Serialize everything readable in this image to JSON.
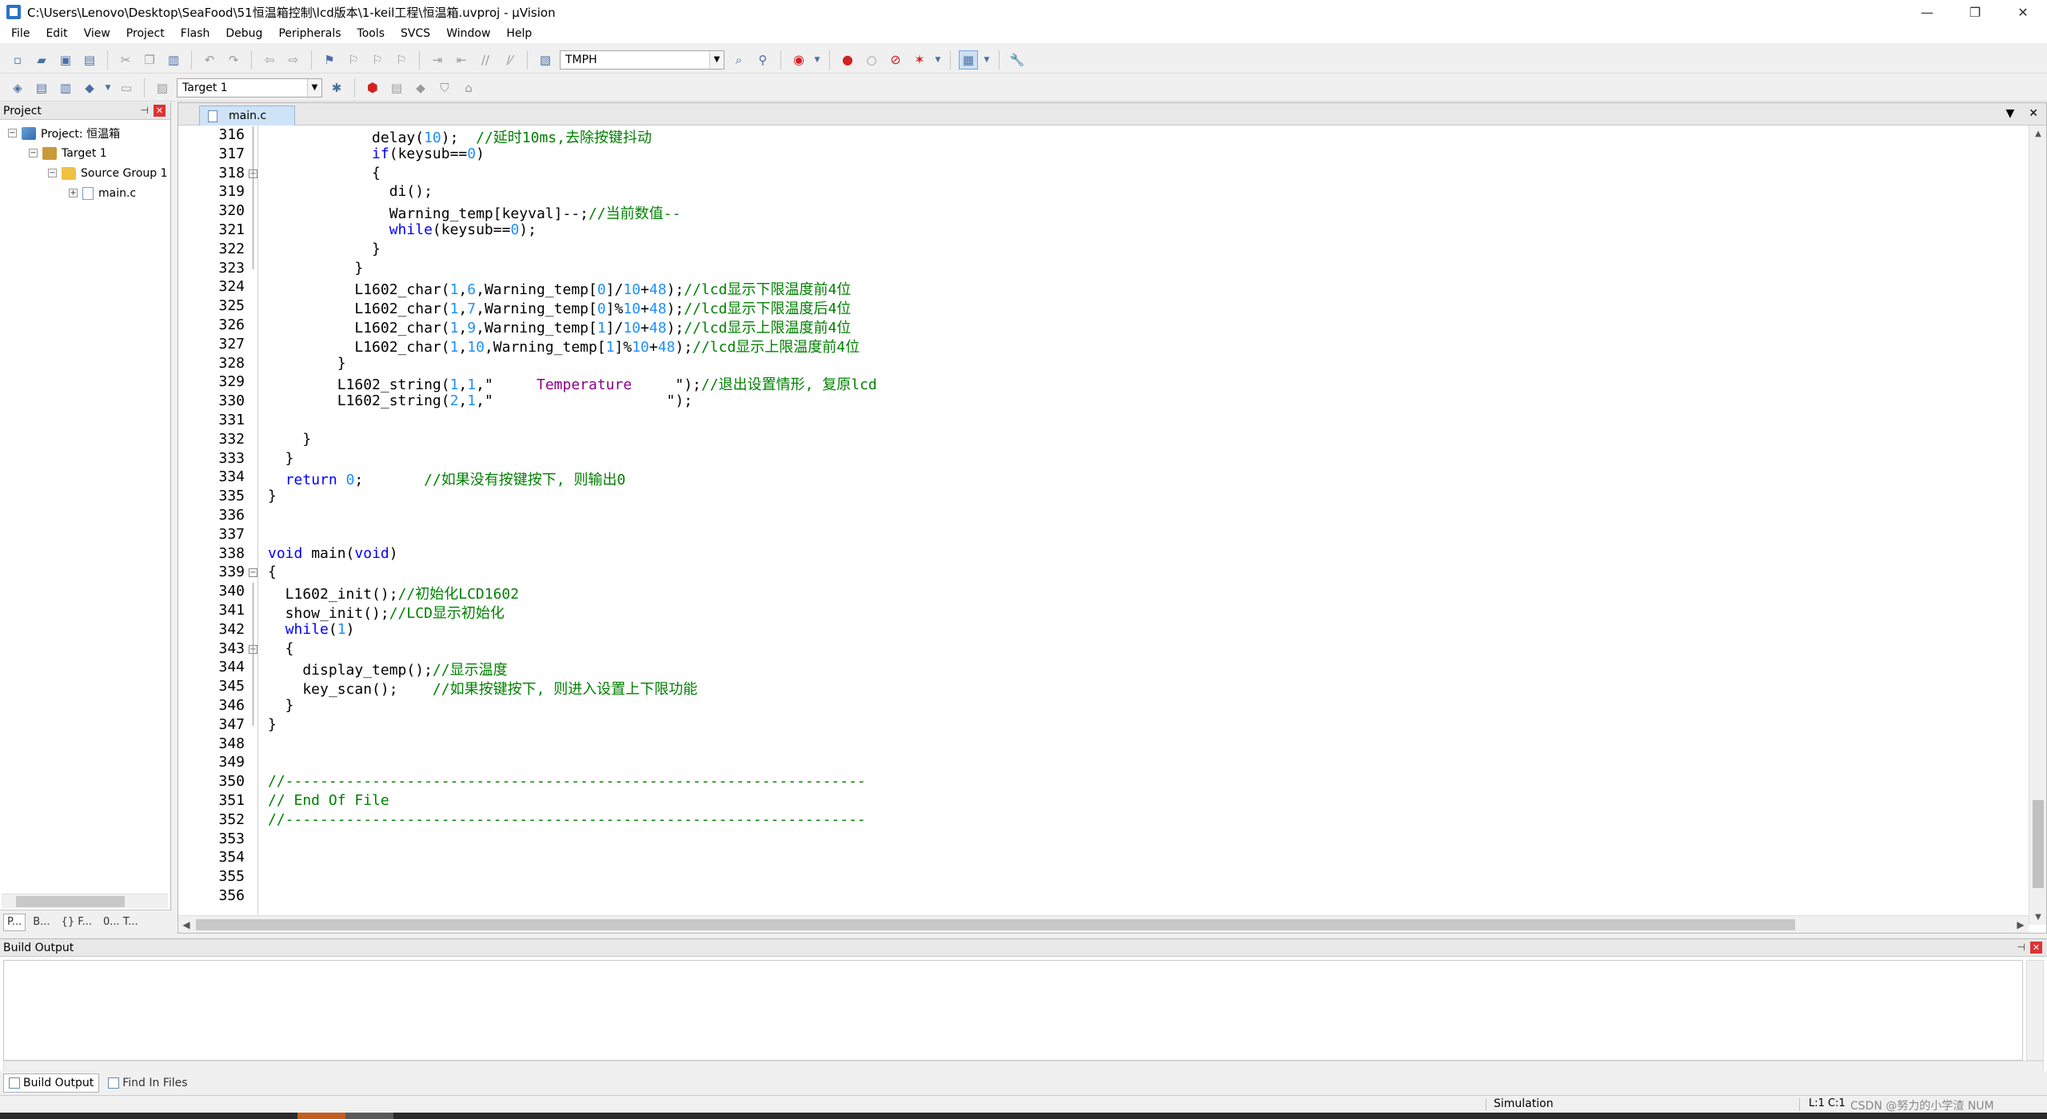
{
  "window": {
    "title": "C:\\Users\\Lenovo\\Desktop\\SeaFood\\51恒温箱控制\\lcd版本\\1-keil工程\\恒温箱.uvproj - µVision",
    "minimize": "—",
    "maximize": "❐",
    "close": "✕"
  },
  "menu": [
    "File",
    "Edit",
    "View",
    "Project",
    "Flash",
    "Debug",
    "Peripherals",
    "Tools",
    "SVCS",
    "Window",
    "Help"
  ],
  "toolbar1": {
    "find_combo_value": "TMPH"
  },
  "toolbar2": {
    "target_combo_value": "Target 1"
  },
  "project_panel": {
    "title": "Project",
    "tree": [
      {
        "label": "Project: 恒温箱",
        "icon": "project-icon",
        "level": 0,
        "expander": "−"
      },
      {
        "label": "Target 1",
        "icon": "target-icon",
        "level": 1,
        "expander": "−"
      },
      {
        "label": "Source Group 1",
        "icon": "folder-icon",
        "level": 2,
        "expander": "−"
      },
      {
        "label": "main.c",
        "icon": "file-icon",
        "level": 3,
        "expander": "+"
      }
    ],
    "tabs": [
      "P...",
      "B...",
      "{} F...",
      "0... T..."
    ]
  },
  "editor": {
    "tab_label": "main.c",
    "tab_menu": "▼",
    "tab_close": "✕",
    "lines": [
      {
        "n": "316",
        "tokens": [
          [
            "            delay(",
            ""
          ],
          [
            "10",
            "num"
          ],
          [
            ");  ",
            ""
          ],
          [
            "//延时10ms,去除按键抖动",
            "cmt"
          ]
        ]
      },
      {
        "n": "317",
        "tokens": [
          [
            "            ",
            ""
          ],
          [
            "if",
            "kw"
          ],
          [
            "(keysub==",
            ""
          ],
          [
            "0",
            "num"
          ],
          [
            ")",
            ""
          ]
        ]
      },
      {
        "n": "318",
        "fold": "−",
        "tokens": [
          [
            "            {",
            ""
          ]
        ]
      },
      {
        "n": "319",
        "tokens": [
          [
            "              di();",
            ""
          ]
        ]
      },
      {
        "n": "320",
        "tokens": [
          [
            "              Warning_temp[keyval]--;",
            ""
          ],
          [
            "//当前数值--",
            "cmt"
          ]
        ]
      },
      {
        "n": "321",
        "tokens": [
          [
            "              ",
            ""
          ],
          [
            "while",
            "kw"
          ],
          [
            "(keysub==",
            ""
          ],
          [
            "0",
            "num"
          ],
          [
            ");",
            ""
          ]
        ]
      },
      {
        "n": "322",
        "tokens": [
          [
            "            }",
            ""
          ]
        ]
      },
      {
        "n": "323",
        "tokens": [
          [
            "          }",
            ""
          ]
        ]
      },
      {
        "n": "324",
        "tokens": [
          [
            "          L1602_char(",
            ""
          ],
          [
            "1",
            "num"
          ],
          [
            ",",
            ""
          ],
          [
            "6",
            "num"
          ],
          [
            ",Warning_temp[",
            ""
          ],
          [
            "0",
            "num"
          ],
          [
            "]/",
            ""
          ],
          [
            "10",
            "num"
          ],
          [
            "+",
            ""
          ],
          [
            "48",
            "num"
          ],
          [
            ");",
            ""
          ],
          [
            "//lcd显示下限温度前4位",
            "cmt"
          ]
        ]
      },
      {
        "n": "325",
        "tokens": [
          [
            "          L1602_char(",
            ""
          ],
          [
            "1",
            "num"
          ],
          [
            ",",
            ""
          ],
          [
            "7",
            "num"
          ],
          [
            ",Warning_temp[",
            ""
          ],
          [
            "0",
            "num"
          ],
          [
            "]%",
            ""
          ],
          [
            "10",
            "num"
          ],
          [
            "+",
            ""
          ],
          [
            "48",
            "num"
          ],
          [
            ");",
            ""
          ],
          [
            "//lcd显示下限温度后4位",
            "cmt"
          ]
        ]
      },
      {
        "n": "326",
        "tokens": [
          [
            "          L1602_char(",
            ""
          ],
          [
            "1",
            "num"
          ],
          [
            ",",
            ""
          ],
          [
            "9",
            "num"
          ],
          [
            ",Warning_temp[",
            ""
          ],
          [
            "1",
            "num"
          ],
          [
            "]/",
            ""
          ],
          [
            "10",
            "num"
          ],
          [
            "+",
            ""
          ],
          [
            "48",
            "num"
          ],
          [
            ");",
            ""
          ],
          [
            "//lcd显示上限温度前4位",
            "cmt"
          ]
        ]
      },
      {
        "n": "327",
        "tokens": [
          [
            "          L1602_char(",
            ""
          ],
          [
            "1",
            "num"
          ],
          [
            ",",
            ""
          ],
          [
            "10",
            "num"
          ],
          [
            ",Warning_temp[",
            ""
          ],
          [
            "1",
            "num"
          ],
          [
            "]%",
            ""
          ],
          [
            "10",
            "num"
          ],
          [
            "+",
            ""
          ],
          [
            "48",
            "num"
          ],
          [
            ");",
            ""
          ],
          [
            "//lcd显示上限温度前4位",
            "cmt"
          ]
        ]
      },
      {
        "n": "328",
        "tokens": [
          [
            "        }",
            ""
          ]
        ]
      },
      {
        "n": "329",
        "tokens": [
          [
            "        L1602_string(",
            ""
          ],
          [
            "1",
            "num"
          ],
          [
            ",",
            ""
          ],
          [
            "1",
            "num"
          ],
          [
            ",\"",
            ""
          ],
          [
            "     Temperature     ",
            "str"
          ],
          [
            "\");",
            ""
          ],
          [
            "//退出设置情形, 复原lcd",
            "cmt"
          ]
        ]
      },
      {
        "n": "330",
        "tokens": [
          [
            "        L1602_string(",
            ""
          ],
          [
            "2",
            "num"
          ],
          [
            ",",
            ""
          ],
          [
            "1",
            "num"
          ],
          [
            ",\"",
            ""
          ],
          [
            "                    ",
            "str"
          ],
          [
            "\");",
            ""
          ]
        ]
      },
      {
        "n": "331",
        "tokens": []
      },
      {
        "n": "332",
        "tokens": [
          [
            "    }",
            ""
          ]
        ]
      },
      {
        "n": "333",
        "tokens": [
          [
            "  }",
            ""
          ]
        ]
      },
      {
        "n": "334",
        "tokens": [
          [
            "  ",
            ""
          ],
          [
            "return",
            "kw"
          ],
          [
            " ",
            ""
          ],
          [
            "0",
            "num"
          ],
          [
            ";       ",
            ""
          ],
          [
            "//如果没有按键按下, 则输出0",
            "cmt"
          ]
        ]
      },
      {
        "n": "335",
        "tokens": [
          [
            "}",
            ""
          ]
        ]
      },
      {
        "n": "336",
        "tokens": []
      },
      {
        "n": "337",
        "tokens": []
      },
      {
        "n": "338",
        "tokens": [
          [
            "void",
            "kw"
          ],
          [
            " main(",
            ""
          ],
          [
            "void",
            "kw"
          ],
          [
            ")",
            ""
          ]
        ]
      },
      {
        "n": "339",
        "fold": "−",
        "tokens": [
          [
            "{",
            ""
          ]
        ]
      },
      {
        "n": "340",
        "tokens": [
          [
            "  L1602_init();",
            ""
          ],
          [
            "//初始化LCD1602",
            "cmt"
          ]
        ]
      },
      {
        "n": "341",
        "tokens": [
          [
            "  show_init();",
            ""
          ],
          [
            "//LCD显示初始化",
            "cmt"
          ]
        ]
      },
      {
        "n": "342",
        "tokens": [
          [
            "  ",
            ""
          ],
          [
            "while",
            "kw"
          ],
          [
            "(",
            ""
          ],
          [
            "1",
            "num"
          ],
          [
            ")",
            ""
          ]
        ]
      },
      {
        "n": "343",
        "fold": "−",
        "tokens": [
          [
            "  {",
            ""
          ]
        ]
      },
      {
        "n": "344",
        "tokens": [
          [
            "    display_temp();",
            ""
          ],
          [
            "//显示温度",
            "cmt"
          ]
        ]
      },
      {
        "n": "345",
        "tokens": [
          [
            "    key_scan();    ",
            ""
          ],
          [
            "//如果按键按下, 则进入设置上下限功能",
            "cmt"
          ]
        ]
      },
      {
        "n": "346",
        "tokens": [
          [
            "  }",
            ""
          ]
        ]
      },
      {
        "n": "347",
        "tokens": [
          [
            "}",
            ""
          ]
        ]
      },
      {
        "n": "348",
        "tokens": []
      },
      {
        "n": "349",
        "tokens": []
      },
      {
        "n": "350",
        "tokens": [
          [
            "//-------------------------------------------------------------------",
            "cmt"
          ]
        ]
      },
      {
        "n": "351",
        "tokens": [
          [
            "// End Of File",
            "cmt"
          ]
        ]
      },
      {
        "n": "352",
        "tokens": [
          [
            "//-------------------------------------------------------------------",
            "cmt"
          ]
        ]
      },
      {
        "n": "353",
        "tokens": []
      },
      {
        "n": "354",
        "tokens": []
      },
      {
        "n": "355",
        "tokens": []
      },
      {
        "n": "356",
        "tokens": []
      }
    ]
  },
  "build_output": {
    "title": "Build Output",
    "tabs": [
      "Build Output",
      "Find In Files"
    ]
  },
  "status": {
    "mode": "Simulation",
    "position": "L:1 C:1",
    "watermark": "CSDN @努力的小学渣 NUM"
  },
  "colors": {
    "keyword": "#0000ff",
    "number": "#1e90ff",
    "comment": "#008000",
    "string": "#8b008b"
  }
}
